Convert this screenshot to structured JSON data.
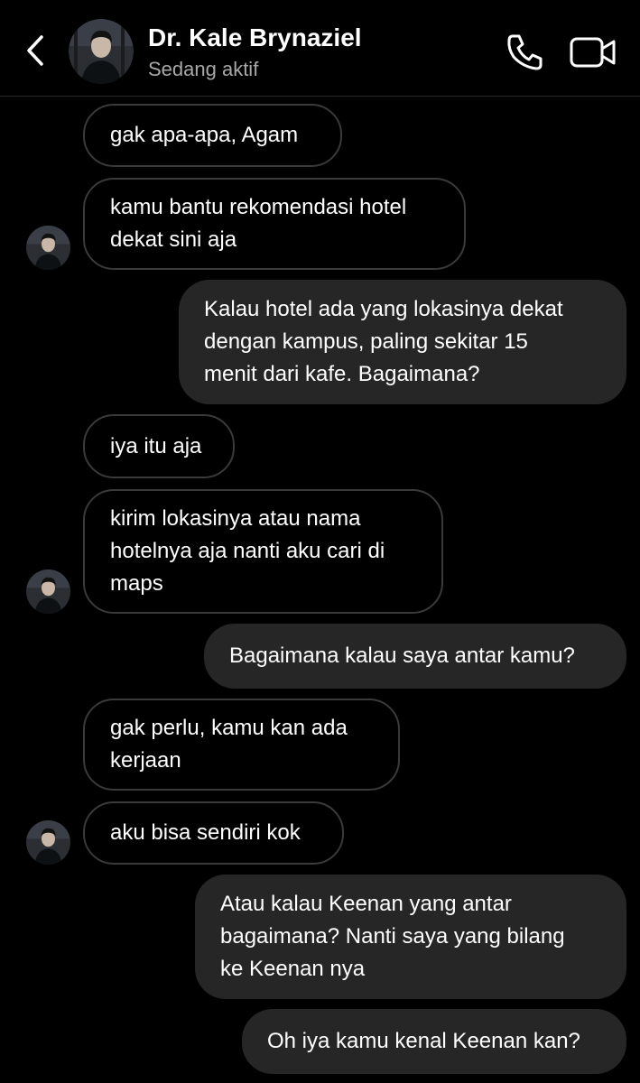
{
  "header": {
    "name": "Dr. Kale Brynaziel",
    "status": "Sedang aktif",
    "icons": {
      "back": "chevron-left-icon",
      "call": "phone-icon",
      "video": "video-camera-icon"
    }
  },
  "messages": [
    {
      "direction": "incoming",
      "text": "gak apa-apa, Agam"
    },
    {
      "direction": "incoming",
      "text": "kamu bantu rekomendasi hotel\ndekat sini aja"
    },
    {
      "direction": "outgoing",
      "text": "Kalau hotel ada yang lokasinya dekat\ndengan kampus, paling sekitar 15\nmenit dari kafe. Bagaimana?"
    },
    {
      "direction": "incoming",
      "text": "iya itu aja"
    },
    {
      "direction": "incoming",
      "text": "kirim lokasinya atau nama\nhotelnya aja nanti aku cari di\nmaps"
    },
    {
      "direction": "outgoing",
      "text": "Bagaimana kalau saya antar kamu?"
    },
    {
      "direction": "incoming",
      "text": "gak perlu, kamu kan ada\nkerjaan"
    },
    {
      "direction": "incoming",
      "text": "aku bisa sendiri kok"
    },
    {
      "direction": "outgoing",
      "text": "Atau kalau Keenan yang antar\nbagaimana? Nanti saya yang bilang\nke Keenan nya"
    },
    {
      "direction": "outgoing",
      "text": "Oh iya kamu kenal Keenan kan?"
    }
  ],
  "colors": {
    "background": "#000000",
    "outgoing_bubble": "#262626",
    "incoming_border": "#3a3a3a",
    "status_text": "#a8a8a8"
  }
}
